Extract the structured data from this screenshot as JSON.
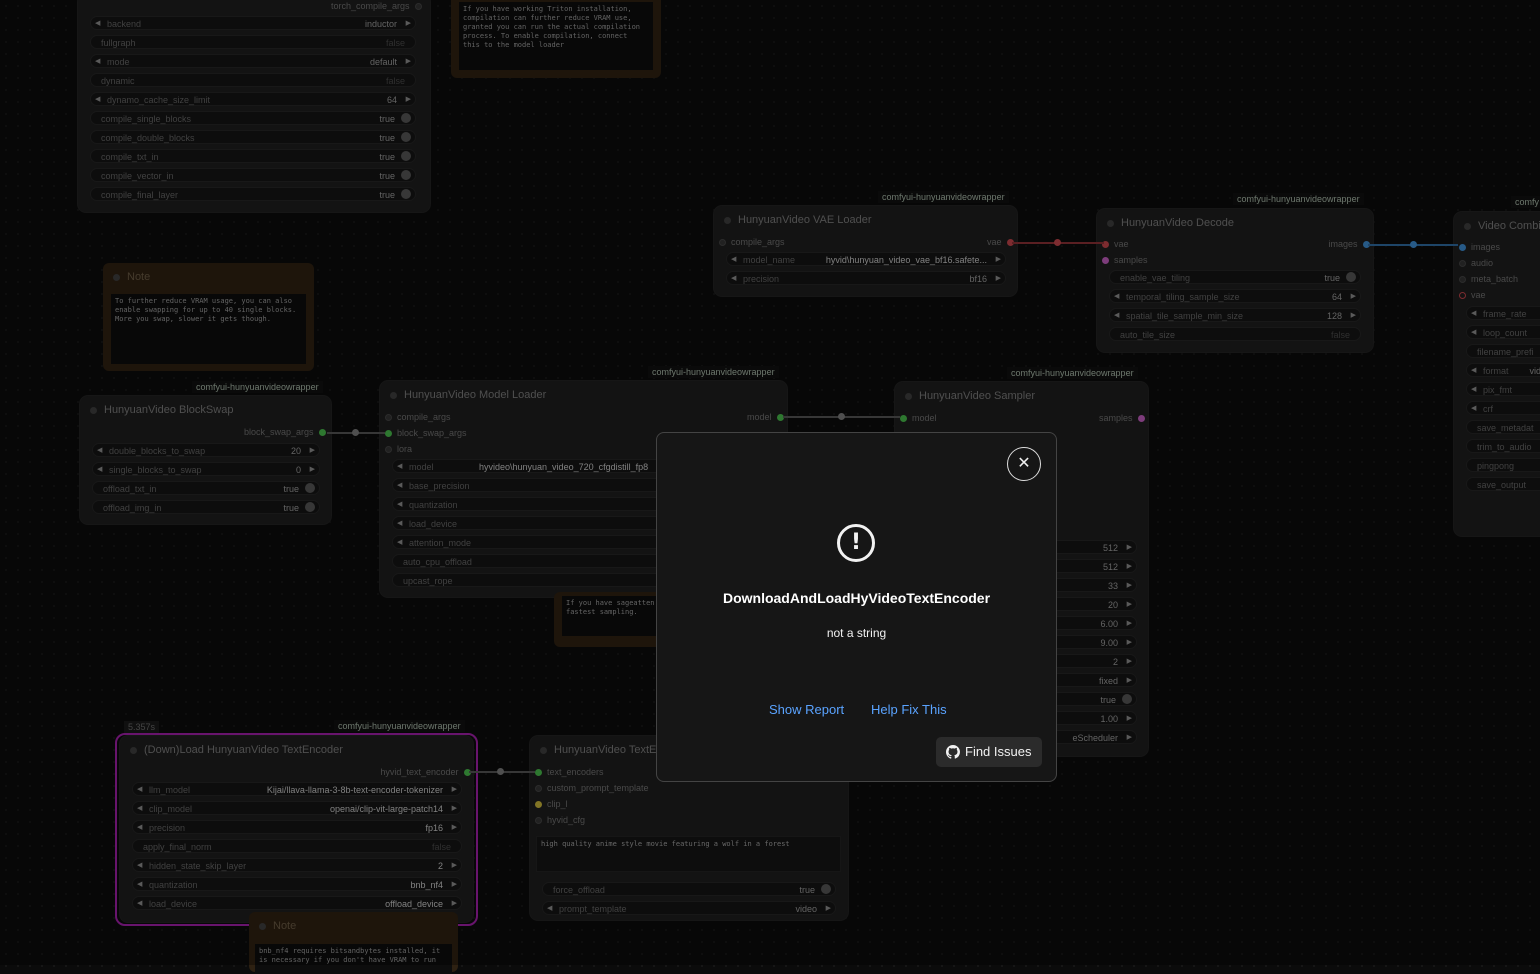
{
  "torch_node": {
    "header": "torch_compile_args",
    "widgets": [
      {
        "label": "backend",
        "value": "inductor"
      },
      {
        "label": "fullgraph",
        "value": "false"
      },
      {
        "label": "mode",
        "value": "default"
      },
      {
        "label": "dynamic",
        "value": "false"
      },
      {
        "label": "dynamo_cache_size_limit",
        "value": "64"
      },
      {
        "label": "compile_single_blocks",
        "value": "true"
      },
      {
        "label": "compile_double_blocks",
        "value": "true"
      },
      {
        "label": "compile_txt_in",
        "value": "true"
      },
      {
        "label": "compile_vector_in",
        "value": "true"
      },
      {
        "label": "compile_final_layer",
        "value": "true"
      }
    ]
  },
  "note_top": {
    "text": "If you have working Triton installation,\ncompilation can further reduce VRAM use,\ngranted you can run the actual compilation\nprocess. To enable compilation, connect\nthis to the model loader"
  },
  "note_left": {
    "title": "Note",
    "text": "To further reduce VRAM usage, you can also\nenable swapping for up to 40 single blocks.\nMore you swap, slower it gets though."
  },
  "blockswap": {
    "badge": "comfyui-hunyuanvideowrapper",
    "title": "HunyuanVideo BlockSwap",
    "output": "block_swap_args",
    "widgets": [
      {
        "label": "double_blocks_to_swap",
        "value": "20"
      },
      {
        "label": "single_blocks_to_swap",
        "value": "0"
      },
      {
        "label": "offload_txt_in",
        "value": "true"
      },
      {
        "label": "offload_img_in",
        "value": "true"
      }
    ]
  },
  "vae_loader": {
    "badge": "comfyui-hunyuanvideowrapper",
    "title": "HunyuanVideo VAE Loader",
    "input": "compile_args",
    "output": "vae",
    "widgets": [
      {
        "label": "model_name",
        "value": "hyvid\\hunyuan_video_vae_bf16.safete..."
      },
      {
        "label": "precision",
        "value": "bf16"
      }
    ]
  },
  "decode": {
    "badge": "comfyui-hunyuanvideowrapper",
    "title": "HunyuanVideo Decode",
    "inputs": [
      "vae",
      "samples"
    ],
    "output": "images",
    "widgets": [
      {
        "label": "enable_vae_tiling",
        "value": "true"
      },
      {
        "label": "temporal_tiling_sample_size",
        "value": "64"
      },
      {
        "label": "spatial_tile_sample_min_size",
        "value": "128"
      },
      {
        "label": "auto_tile_size",
        "value": "false"
      }
    ]
  },
  "video_combine": {
    "badge": "comfy",
    "title": "Video Combine",
    "inputs": [
      "images",
      "audio",
      "meta_batch",
      "vae"
    ],
    "widgets": [
      {
        "label": "frame_rate",
        "value": ""
      },
      {
        "label": "loop_count",
        "value": ""
      },
      {
        "label": "filename_prefi",
        "value": ""
      },
      {
        "label": "format",
        "value": "video"
      },
      {
        "label": "pix_fmt",
        "value": ""
      },
      {
        "label": "crf",
        "value": ""
      },
      {
        "label": "save_metadat",
        "value": ""
      },
      {
        "label": "trim_to_audio",
        "value": ""
      },
      {
        "label": "pingpong",
        "value": ""
      },
      {
        "label": "save_output",
        "value": ""
      }
    ]
  },
  "model_loader": {
    "badge": "comfyui-hunyuanvideowrapper",
    "title": "HunyuanVideo Model Loader",
    "inputs": [
      "compile_args",
      "block_swap_args",
      "lora"
    ],
    "output": "model",
    "widgets": [
      {
        "label": "model",
        "value": "hyvideo\\hunyuan_video_720_cfgdistill_fp8"
      },
      {
        "label": "base_precision",
        "value": ""
      },
      {
        "label": "quantization",
        "value": ""
      },
      {
        "label": "load_device",
        "value": ""
      },
      {
        "label": "attention_mode",
        "value": ""
      },
      {
        "label": "auto_cpu_offload",
        "value": ""
      },
      {
        "label": "upcast_rope",
        "value": ""
      }
    ]
  },
  "note_sage": {
    "text": "If you have sageatten\nfastest sampling."
  },
  "sampler": {
    "badge": "comfyui-hunyuanvideowrapper",
    "title": "HunyuanVideo Sampler",
    "input": "model",
    "output": "samples",
    "values": [
      "512",
      "512",
      "33",
      "20",
      "6.00",
      "9.00",
      "2",
      "fixed",
      "true",
      "1.00",
      "eScheduler"
    ]
  },
  "text_encoder_loader": {
    "timing": "5.357s",
    "badge": "comfyui-hunyuanvideowrapper",
    "title": "(Down)Load HunyuanVideo TextEncoder",
    "output": "hyvid_text_encoder",
    "widgets": [
      {
        "label": "llm_model",
        "value": "Kijai/llava-llama-3-8b-text-encoder-tokenizer"
      },
      {
        "label": "clip_model",
        "value": "openai/clip-vit-large-patch14"
      },
      {
        "label": "precision",
        "value": "fp16"
      },
      {
        "label": "apply_final_norm",
        "value": "false"
      },
      {
        "label": "hidden_state_skip_layer",
        "value": "2"
      },
      {
        "label": "quantization",
        "value": "bnb_nf4"
      },
      {
        "label": "load_device",
        "value": "offload_device"
      }
    ]
  },
  "text_encode": {
    "title": "HunyuanVideo TextE",
    "inputs": [
      "text_encoders",
      "custom_prompt_template",
      "clip_l",
      "hyvid_cfg"
    ],
    "prompt": "high quality anime style movie featuring a wolf in a forest",
    "widgets": [
      {
        "label": "force_offload",
        "value": "true"
      },
      {
        "label": "prompt_template",
        "value": "video"
      }
    ]
  },
  "note_bottom": {
    "title": "Note",
    "text": "bnb_nf4 requires bitsandbytes installed, it\nis necessary if you don't have VRAM to run"
  },
  "dialog": {
    "title": "DownloadAndLoadHyVideoTextEncoder",
    "message": "not a string",
    "show_report": "Show Report",
    "help_fix": "Help Fix This",
    "find_issues": "Find Issues",
    "close_symbol": "✕",
    "alert_symbol": "!"
  },
  "colors": {
    "link_blue": "#5aa3ff",
    "wire_red": "#c0444a",
    "wire_blue": "#3c8bd0",
    "wire_pink": "#c05dbd",
    "group_purple": "#a020a8"
  }
}
